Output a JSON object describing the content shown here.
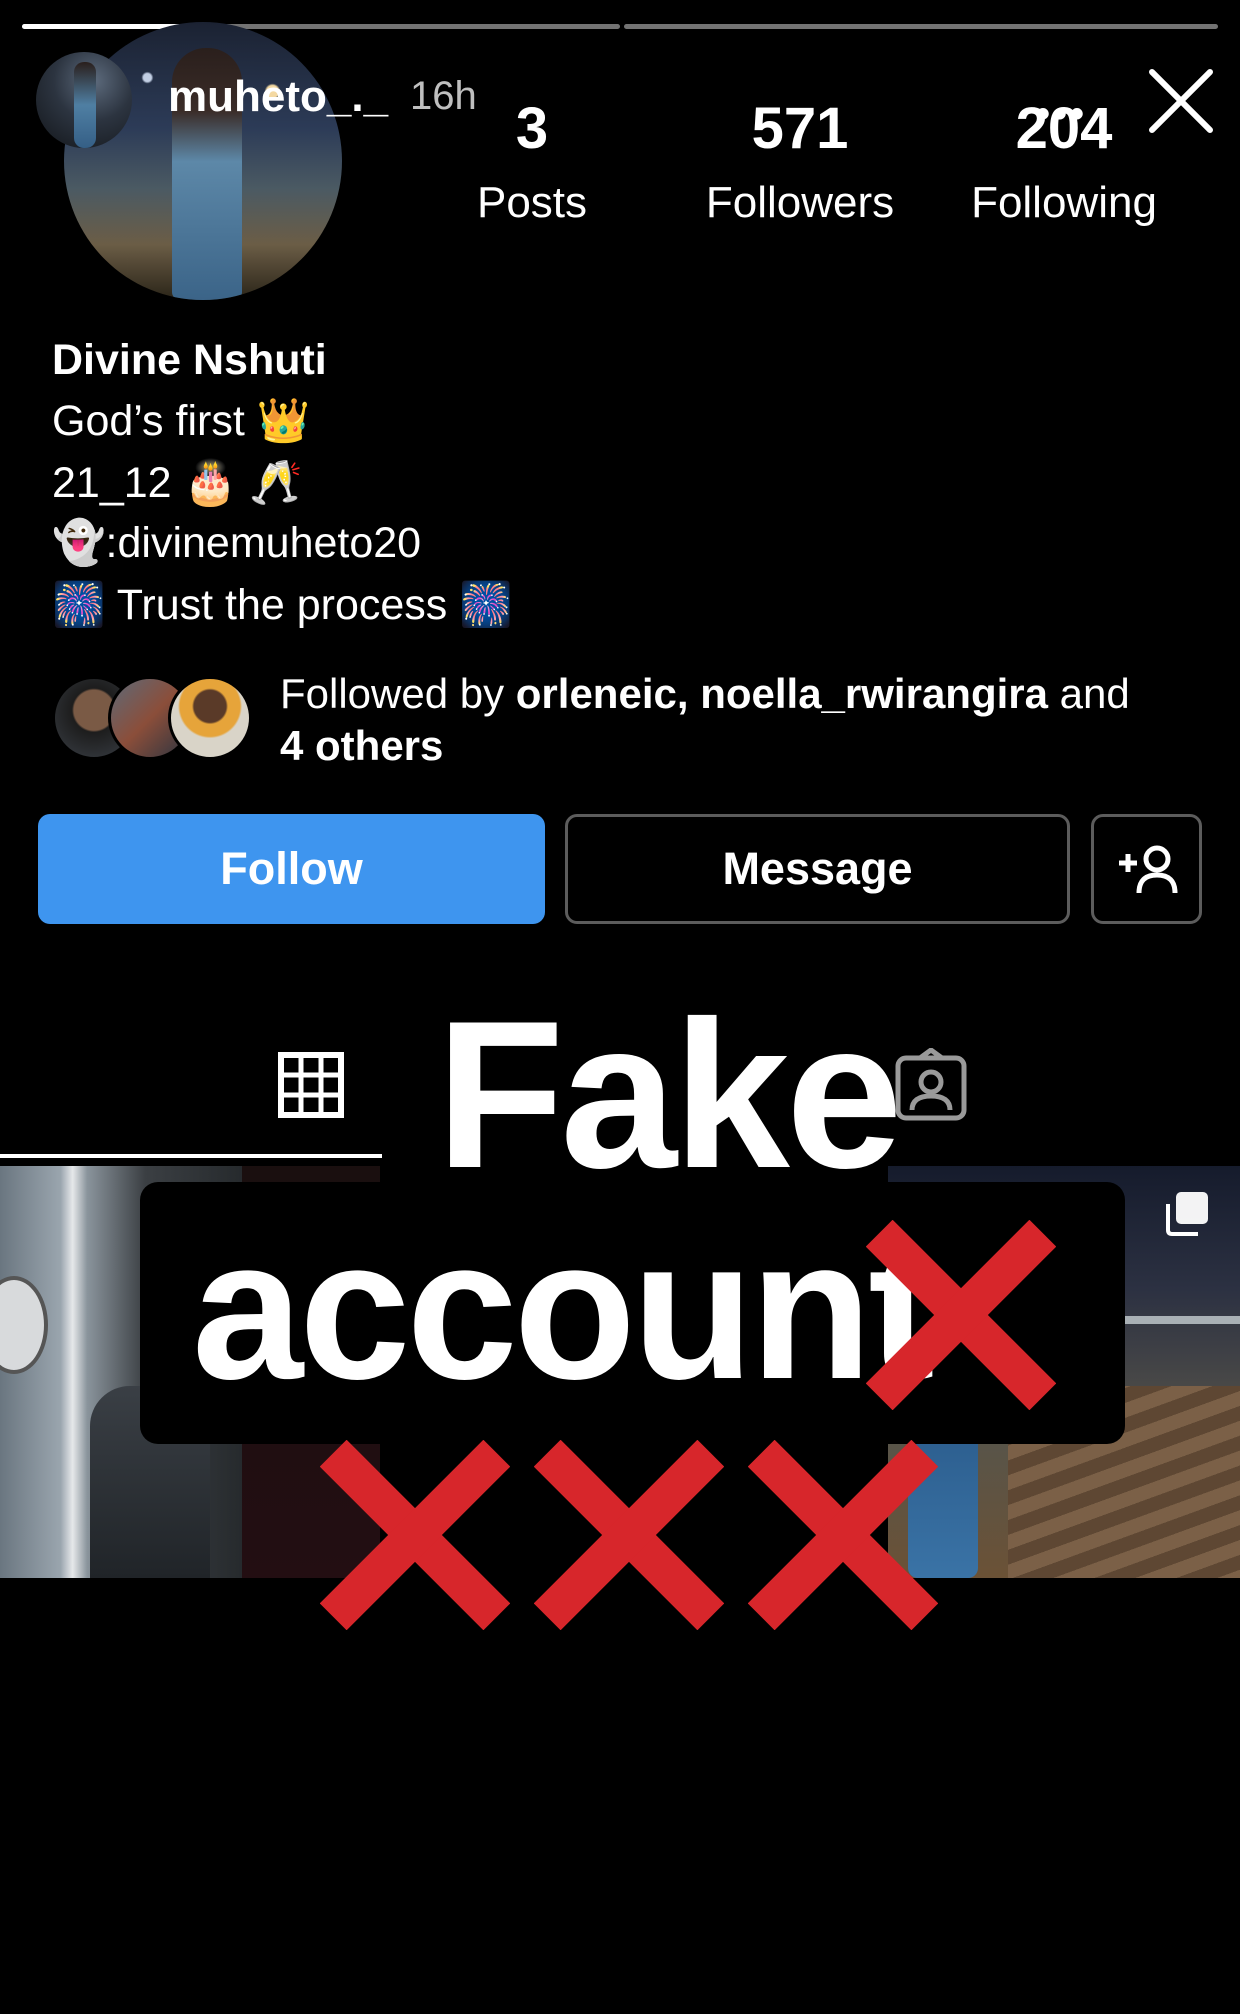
{
  "story": {
    "progress": [
      0.3,
      0.0
    ],
    "username": "muheto_._",
    "time": "16h"
  },
  "profile": {
    "stats": [
      {
        "value": "3",
        "label": "Posts"
      },
      {
        "value": "571",
        "label": "Followers"
      },
      {
        "value": "204",
        "label": "Following"
      }
    ],
    "more": "•••",
    "bio": {
      "name": "Divine Nshuti",
      "line1": "God’s first 👑",
      "line2": "21_12 🎂 🥂",
      "line3": "👻:divinemuheto20",
      "line4": "🎆 Trust the process 🎆"
    },
    "followed_by": {
      "prefix": "Followed by ",
      "names": "orleneic, noella_rwirangira",
      "and": " and",
      "others": "4 others"
    },
    "buttons": {
      "follow": "Follow",
      "message": "Message",
      "add_user": "+👤"
    }
  },
  "overlay": {
    "fake": "Fake",
    "account": "account",
    "crosses": [
      "❌",
      "❌",
      "❌",
      "❌"
    ]
  },
  "colors": {
    "follow_blue": "#3e95ef",
    "cross_red": "#d7262b"
  }
}
